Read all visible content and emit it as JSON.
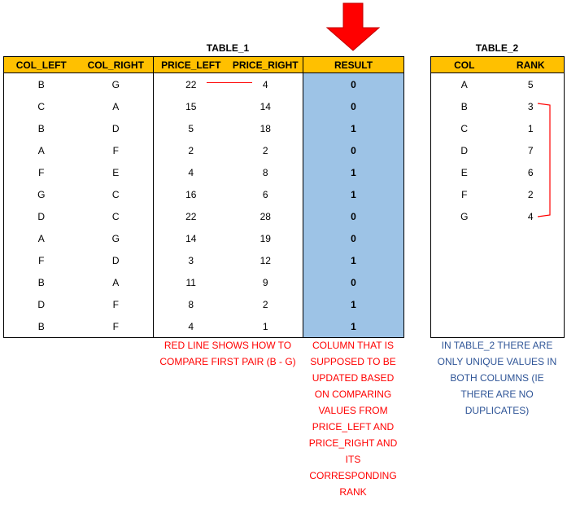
{
  "arrow": {
    "color": "#FF0000",
    "points_to": "RESULT column"
  },
  "table1": {
    "title": "TABLE_1",
    "headers": [
      "COL_LEFT",
      "COL_RIGHT",
      "PRICE_LEFT",
      "PRICE_RIGHT",
      "RESULT"
    ],
    "rows": [
      [
        "B",
        "G",
        "22",
        "4",
        "0"
      ],
      [
        "C",
        "A",
        "15",
        "14",
        "0"
      ],
      [
        "B",
        "D",
        "5",
        "18",
        "1"
      ],
      [
        "A",
        "F",
        "2",
        "2",
        "0"
      ],
      [
        "F",
        "E",
        "4",
        "8",
        "1"
      ],
      [
        "G",
        "C",
        "16",
        "6",
        "1"
      ],
      [
        "D",
        "C",
        "22",
        "28",
        "0"
      ],
      [
        "A",
        "G",
        "14",
        "19",
        "0"
      ],
      [
        "F",
        "D",
        "3",
        "12",
        "1"
      ],
      [
        "B",
        "A",
        "11",
        "9",
        "0"
      ],
      [
        "D",
        "F",
        "8",
        "2",
        "1"
      ],
      [
        "B",
        "F",
        "4",
        "1",
        "1"
      ]
    ],
    "header_color": "#FFC000",
    "result_color": "#9DC3E6"
  },
  "table2": {
    "title": "TABLE_2",
    "headers": [
      "COL",
      "RANK"
    ],
    "rows": [
      [
        "A",
        "5"
      ],
      [
        "B",
        "3"
      ],
      [
        "C",
        "1"
      ],
      [
        "D",
        "7"
      ],
      [
        "E",
        "6"
      ],
      [
        "F",
        "2"
      ],
      [
        "G",
        "4"
      ]
    ]
  },
  "notes": {
    "red_line": [
      "RED LINE SHOWS HOW TO",
      "COMPARE FIRST PAIR (B - G)"
    ],
    "result_column": [
      "COLUMN THAT IS",
      "SUPPOSED TO BE",
      "UPDATED BASED",
      "ON COMPARING",
      "VALUES FROM",
      "PRICE_LEFT AND",
      "PRICE_RIGHT AND",
      "ITS",
      "CORRESPONDING",
      "RANK"
    ],
    "table2": [
      "IN TABLE_2 THERE ARE",
      "ONLY UNIQUE VALUES IN",
      "BOTH COLUMNS (IE",
      "THERE ARE NO",
      "DUPLICATES)"
    ]
  }
}
